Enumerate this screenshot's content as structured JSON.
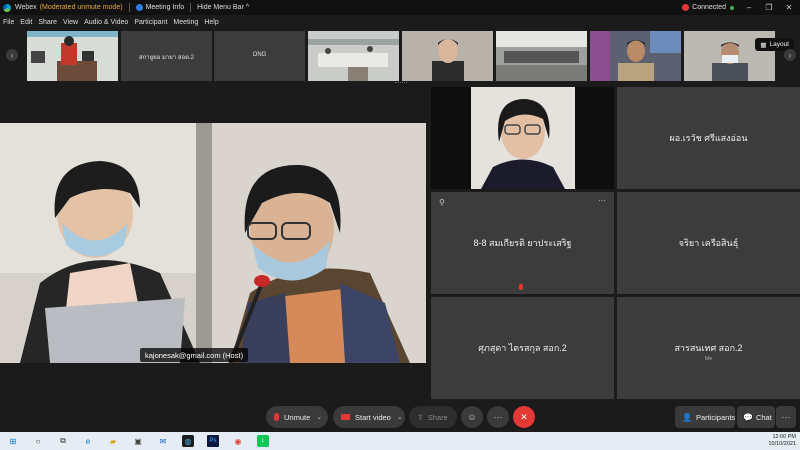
{
  "titlebar": {
    "app_name": "Webex",
    "mode": "(Moderated unmute mode)",
    "meeting_info": "Meeting Info",
    "hide_menu": "Hide Menu Bar",
    "chevron": "^",
    "status": "Connected"
  },
  "menu": [
    "File",
    "Edit",
    "Share",
    "View",
    "Audio & Video",
    "Participant",
    "Meeting",
    "Help"
  ],
  "filmstrip": {
    "tiles": [
      {
        "label": ""
      },
      {
        "label": "สกายูยอ มายา สอต.2"
      },
      {
        "label": "ONG"
      },
      {
        "label": ""
      },
      {
        "label": ""
      },
      {
        "label": ""
      },
      {
        "label": ""
      },
      {
        "label": ""
      }
    ],
    "layout_label": "Layout"
  },
  "main": {
    "host_label": "kajonesak@gmail.com (Host)"
  },
  "grid": [
    {
      "name": "",
      "sub": ""
    },
    {
      "name": "ผอ.เรวัช ศรีแสงอ่อน",
      "sub": ""
    },
    {
      "name": "8-8 สมเกียรติ ยาประเสริฐ",
      "sub": ""
    },
    {
      "name": "จริยา เครือสินธุ์",
      "sub": ""
    },
    {
      "name": "ศุภสุดา ไตรสกุล สอก.2",
      "sub": ""
    },
    {
      "name": "สารสนเทศ สอก.2",
      "sub": "Me"
    }
  ],
  "controls": {
    "unmute": "Unmute",
    "start_video": "Start video",
    "share": "Share",
    "participants": "Participants",
    "chat": "Chat"
  },
  "taskbar": {
    "time": "12:00 PM",
    "date": "10/10/2021"
  },
  "colors": {
    "end_call": "#e53935",
    "accent": "#2f7de1",
    "mode_text": "#e8a43c"
  }
}
